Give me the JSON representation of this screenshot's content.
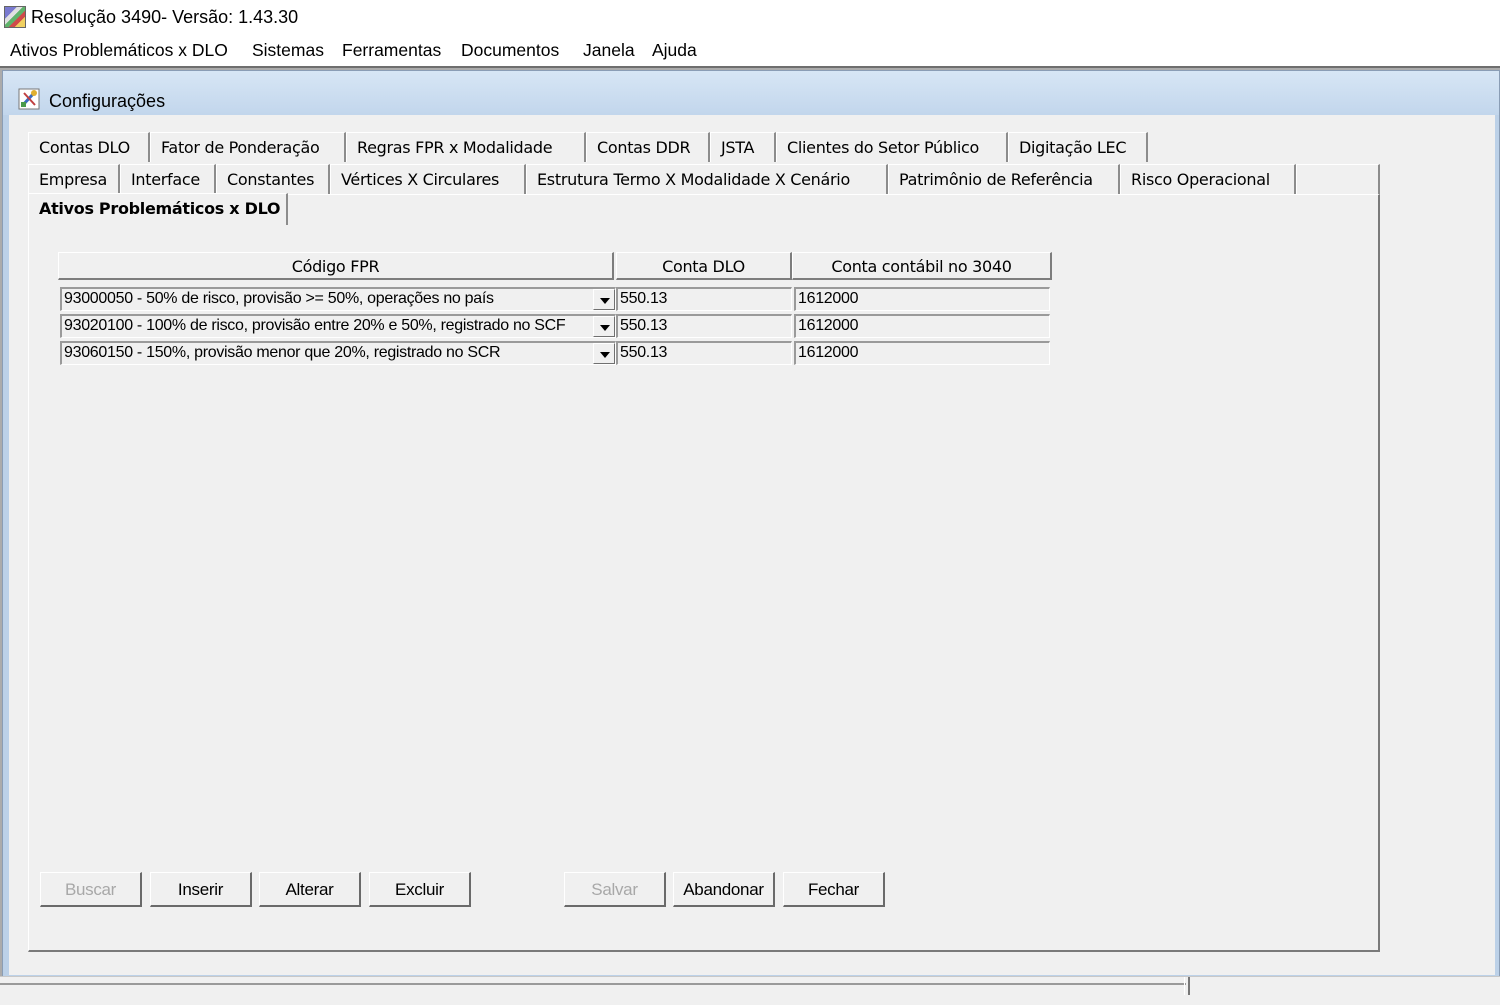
{
  "app": {
    "title": "Resolução 3490- Versão: 1.43.30"
  },
  "menu": [
    "Ativos Problemáticos x DLO",
    "Sistemas",
    "Ferramentas",
    "Documentos",
    "Janela",
    "Ajuda"
  ],
  "window": {
    "title": "Configurações"
  },
  "tabs": {
    "row1": [
      "Contas DLO",
      "Fator de Ponderação",
      "Regras FPR x Modalidade",
      "Contas DDR",
      "JSTA",
      "Clientes do Setor Público",
      "Digitação LEC"
    ],
    "row2": [
      "Empresa",
      "Interface",
      "Constantes",
      "Vértices X Circulares",
      "Estrutura Termo X Modalidade X Cenário",
      "Patrimônio de Referência",
      "Risco Operacional"
    ],
    "active": "Ativos Problemáticos x DLO"
  },
  "grid": {
    "headers": [
      "Código FPR",
      "Conta DLO",
      "Conta contábil no 3040"
    ],
    "rows": [
      {
        "codigo": "93000050 - 50% de risco, provisão >= 50%, operações no país",
        "conta_dlo": "550.13",
        "conta_contabil": "1612000"
      },
      {
        "codigo": "93020100 - 100% de risco, provisão entre 20% e 50%,  registrado no SCF",
        "conta_dlo": "550.13",
        "conta_contabil": "1612000"
      },
      {
        "codigo": "93060150 - 150%, provisão menor que 20%,  registrado no SCR",
        "conta_dlo": "550.13",
        "conta_contabil": "1612000"
      }
    ]
  },
  "buttons": {
    "buscar": "Buscar",
    "inserir": "Inserir",
    "alterar": "Alterar",
    "excluir": "Excluir",
    "salvar": "Salvar",
    "abandonar": "Abandonar",
    "fechar": "Fechar"
  }
}
